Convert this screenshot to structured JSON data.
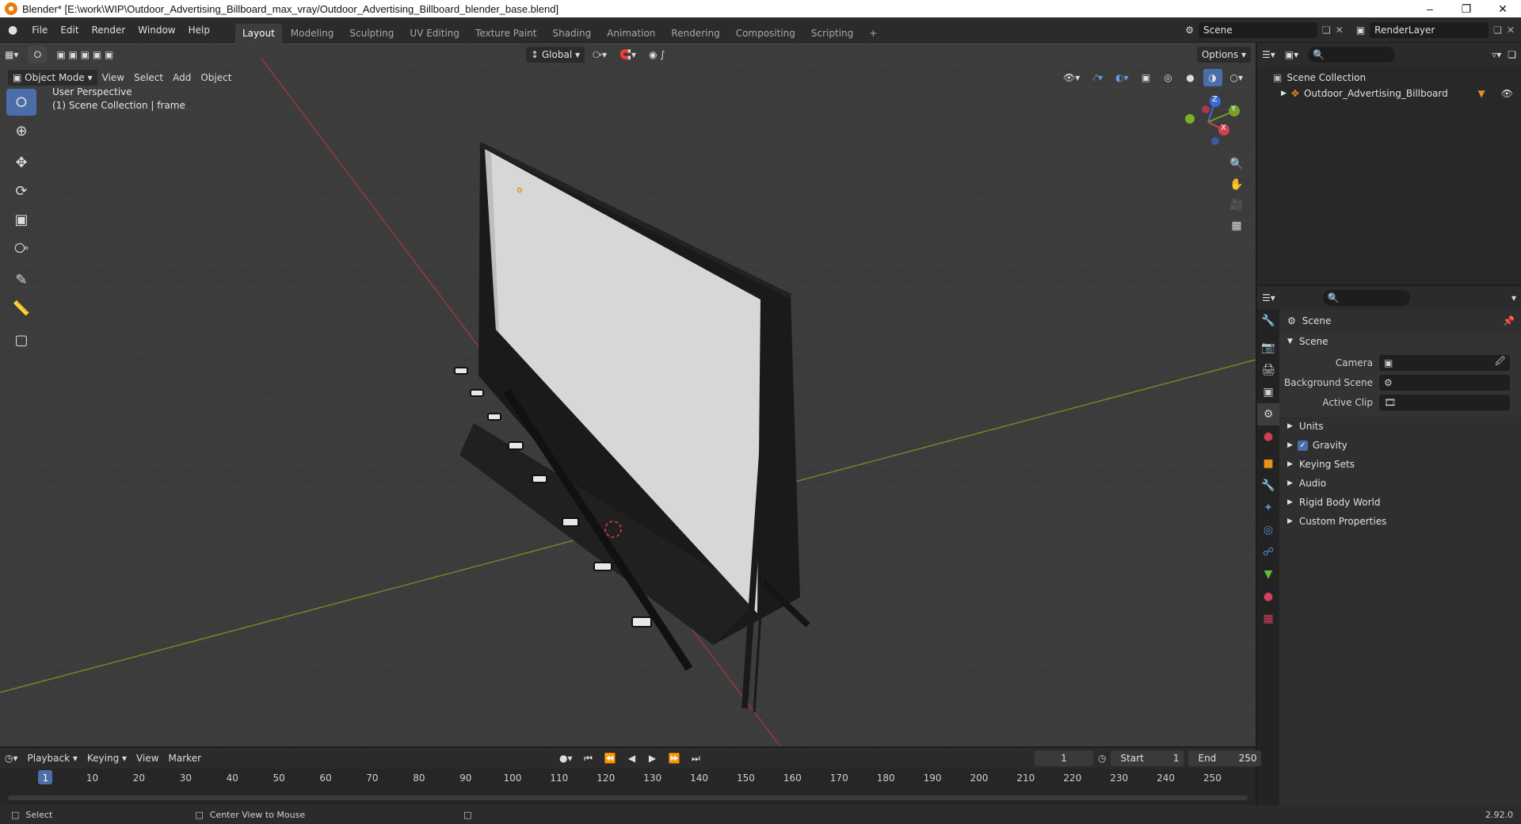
{
  "window": {
    "title": "Blender* [E:\\work\\WIP\\Outdoor_Advertising_Billboard_max_vray/Outdoor_Advertising_Billboard_blender_base.blend]"
  },
  "menu": {
    "items": [
      "File",
      "Edit",
      "Render",
      "Window",
      "Help"
    ]
  },
  "workspaces": [
    "Layout",
    "Modeling",
    "Sculpting",
    "UV Editing",
    "Texture Paint",
    "Shading",
    "Animation",
    "Rendering",
    "Compositing",
    "Scripting"
  ],
  "active_workspace": "Layout",
  "scene_selector": {
    "scene": "Scene",
    "render_layer": "RenderLayer"
  },
  "viewport_header": {
    "transform_orientation": "Global",
    "options_label": "Options",
    "mode": "Object Mode",
    "menus": [
      "View",
      "Select",
      "Add",
      "Object"
    ]
  },
  "viewport": {
    "perspective": "User Perspective",
    "collection_info": "(1) Scene Collection | frame",
    "gizmo_axes": {
      "x": "X",
      "y": "Y",
      "z": "Z"
    }
  },
  "outliner": {
    "root": "Scene Collection",
    "items": [
      "Outdoor_Advertising_Billboard"
    ]
  },
  "properties": {
    "header": "Scene",
    "section": "Scene",
    "fields": [
      {
        "label": "Camera",
        "value": ""
      },
      {
        "label": "Background Scene",
        "value": ""
      },
      {
        "label": "Active Clip",
        "value": ""
      }
    ],
    "subsections": [
      "Units",
      "Gravity",
      "Keying Sets",
      "Audio",
      "Rigid Body World",
      "Custom Properties"
    ],
    "gravity_checked": true
  },
  "timeline": {
    "menus": [
      "Playback",
      "Keying",
      "View",
      "Marker"
    ],
    "current_frame": "1",
    "start_label": "Start",
    "start": "1",
    "end_label": "End",
    "end": "250",
    "ticks": [
      "1",
      "10",
      "20",
      "30",
      "40",
      "50",
      "60",
      "70",
      "80",
      "90",
      "100",
      "110",
      "120",
      "130",
      "140",
      "150",
      "160",
      "170",
      "180",
      "190",
      "200",
      "210",
      "220",
      "230",
      "240",
      "250"
    ]
  },
  "statusbar": {
    "left": "Select",
    "middle": "Center View to Mouse",
    "version": "2.92.0"
  },
  "colors": {
    "accent": "#4b6ea8",
    "x_axis": "#a83a3a",
    "y_axis": "#7a9a2a",
    "z_axis": "#3a6ad8"
  }
}
